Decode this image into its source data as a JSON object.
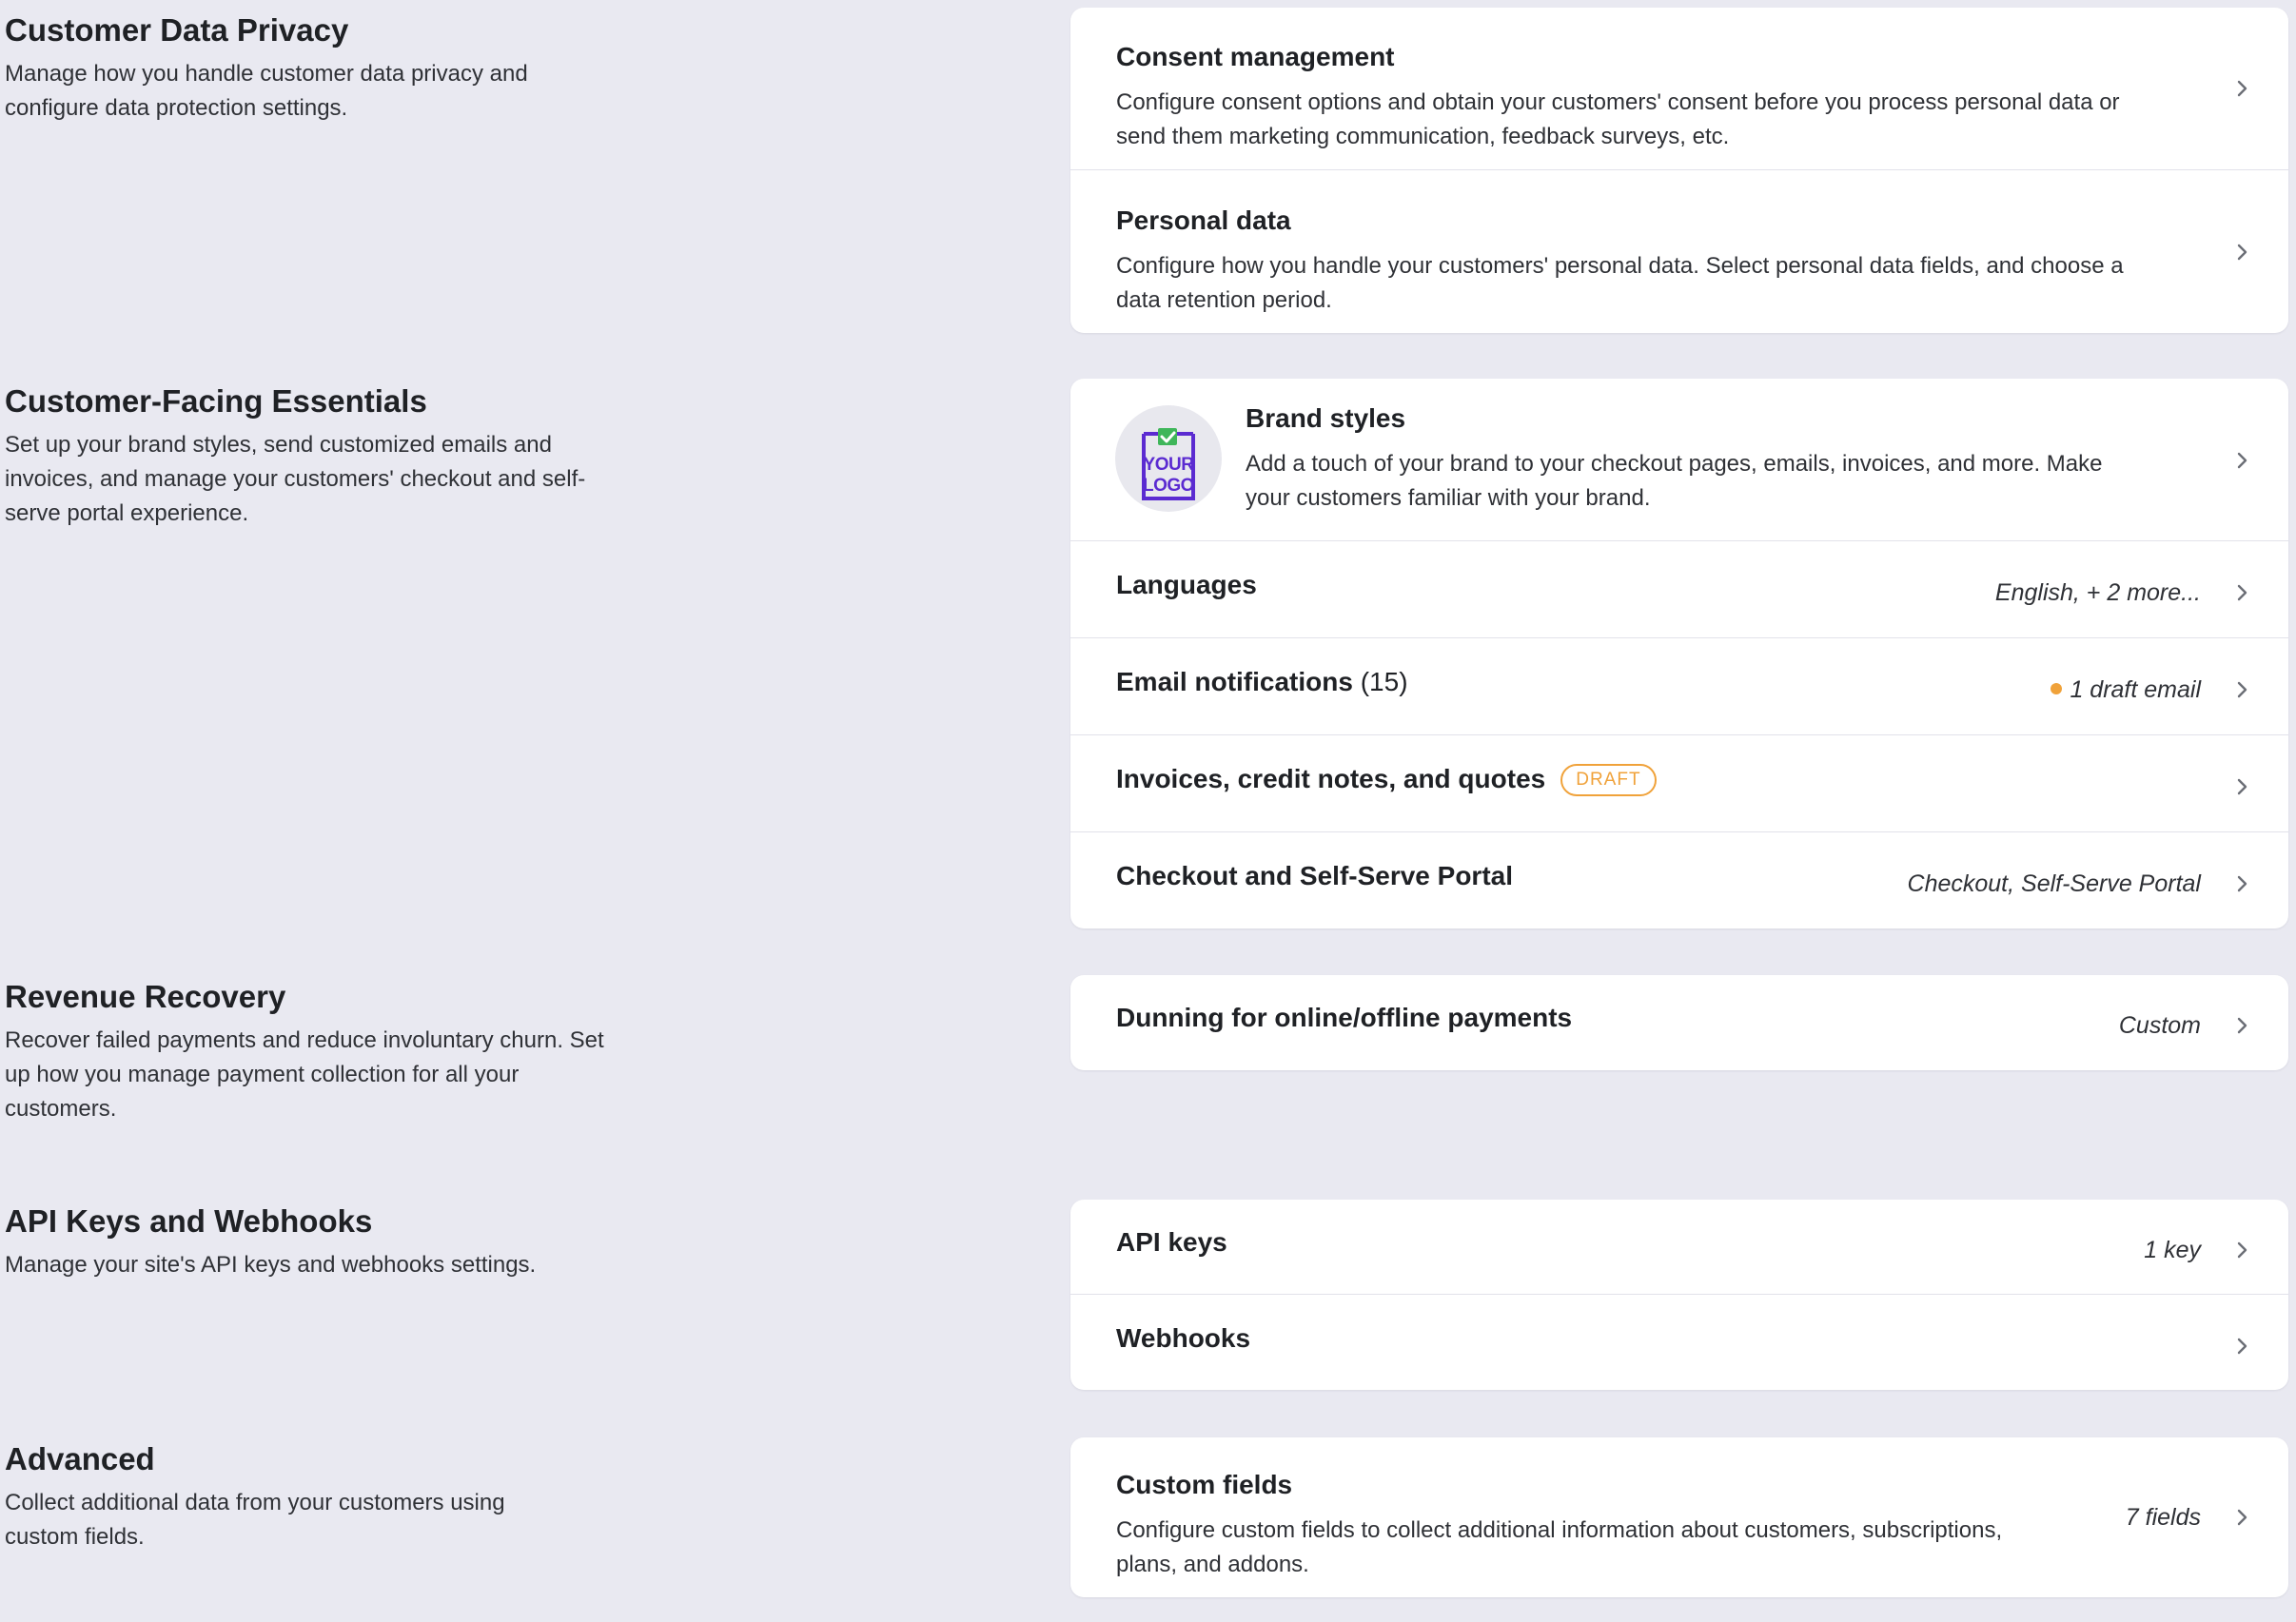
{
  "sections": [
    {
      "title": "Customer Data Privacy",
      "desc": "Manage how you handle customer data privacy and configure data protection settings.",
      "rows": [
        {
          "title": "Consent management",
          "desc": "Configure consent options and obtain your customers' consent before you process personal data or send them marketing communication, feedback surveys, etc."
        },
        {
          "title": "Personal data",
          "desc": "Configure how you handle your customers' personal data. Select personal data fields, and choose a data retention period."
        }
      ]
    },
    {
      "title": "Customer-Facing Essentials",
      "desc": "Set up your brand styles, send customized emails and invoices, and manage your customers' checkout and self-serve portal experience.",
      "rows": [
        {
          "title": "Brand styles",
          "desc": "Add a touch of your brand to your checkout pages, emails, invoices, and more. Make your customers familiar with your brand.",
          "logo_line1": "YOUR",
          "logo_line2": "LOGO"
        },
        {
          "title": "Languages",
          "value": "English, + 2 more..."
        },
        {
          "title": "Email notifications",
          "count": "(15)",
          "value": "1 draft email"
        },
        {
          "title": "Invoices, credit notes, and quotes",
          "badge": "DRAFT"
        },
        {
          "title": "Checkout and Self-Serve Portal",
          "value": "Checkout, Self-Serve Portal"
        }
      ]
    },
    {
      "title": "Revenue Recovery",
      "desc": "Recover failed payments and reduce involuntary churn. Set up how you manage payment collection for all your customers.",
      "rows": [
        {
          "title": "Dunning for online/offline payments",
          "value": "Custom"
        }
      ]
    },
    {
      "title": "API Keys and Webhooks",
      "desc": "Manage your site's API keys and webhooks settings.",
      "rows": [
        {
          "title": "API keys",
          "value": "1 key"
        },
        {
          "title": "Webhooks"
        }
      ]
    },
    {
      "title": "Advanced",
      "desc": "Collect additional data from your customers using custom fields.",
      "rows": [
        {
          "title": "Custom fields",
          "desc": "Configure custom fields to collect additional information about customers, subscriptions, plans, and addons.",
          "value": "7 fields"
        }
      ]
    }
  ],
  "colors": {
    "background": "#e9e9f1",
    "draft_accent": "#f0a23a",
    "logo_purple": "#5b2bd1",
    "check_green": "#3fb65a"
  },
  "icons": {
    "chevron": "chevron-right-icon",
    "logo": "brand-logo-placeholder-icon"
  }
}
